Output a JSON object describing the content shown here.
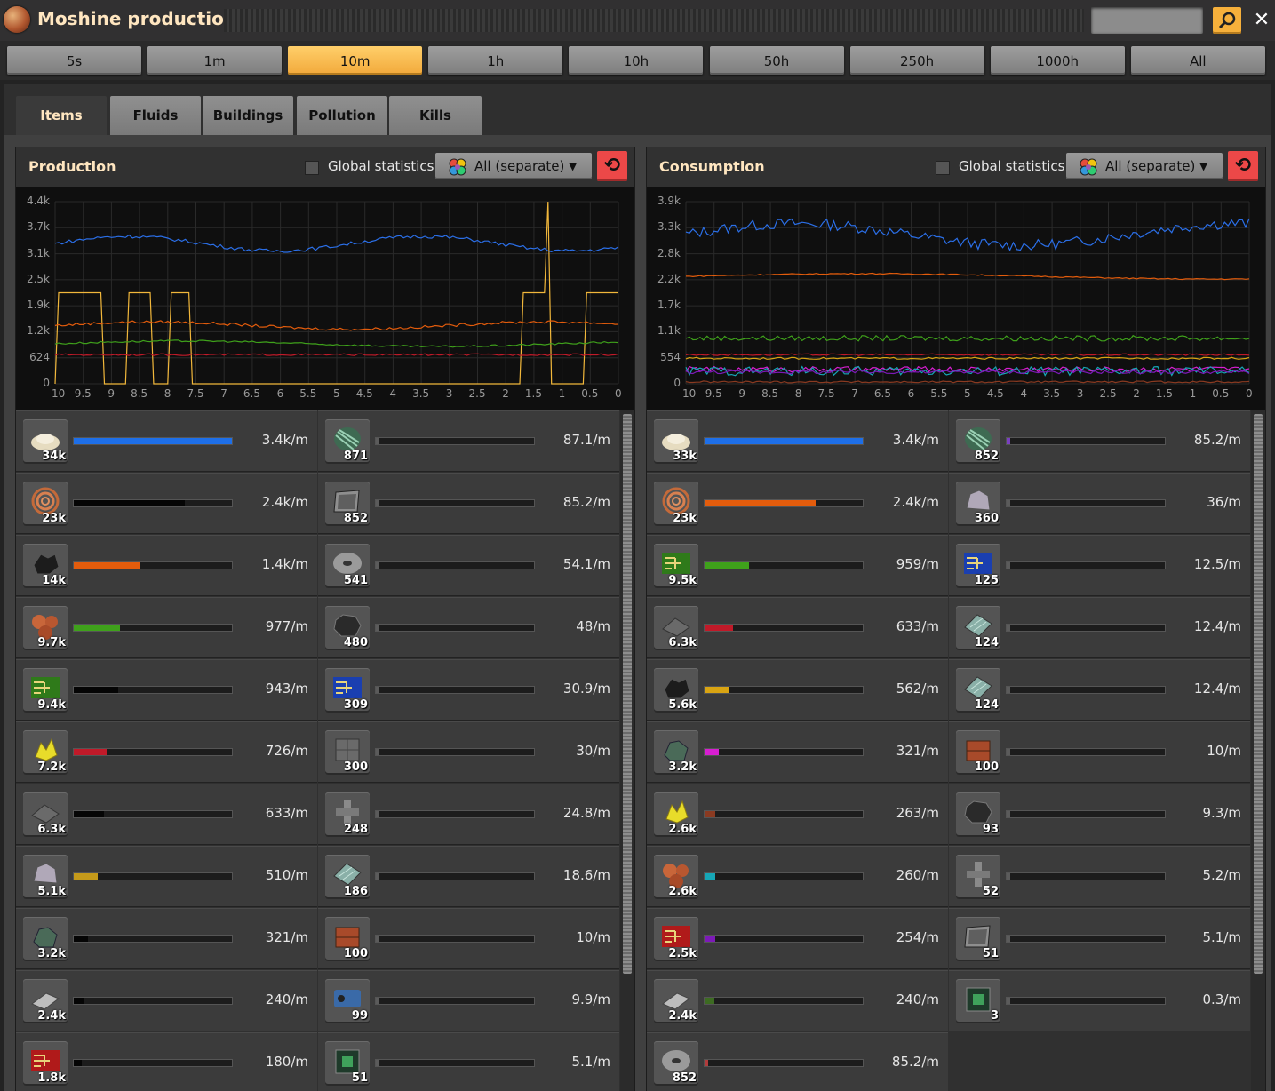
{
  "window": {
    "title": "Moshine production",
    "close_label": "✕"
  },
  "time_buttons": [
    "5s",
    "1m",
    "10m",
    "1h",
    "10h",
    "50h",
    "250h",
    "1000h",
    "All"
  ],
  "active_time": "10m",
  "tabs": [
    "Items",
    "Fluids",
    "Buildings",
    "Pollution",
    "Kills"
  ],
  "active_tab": "Items",
  "production": {
    "title": "Production",
    "global_label": "Global statistics",
    "dropdown_label": "All (separate)",
    "chart_data": {
      "type": "line",
      "x_labels": [
        "10",
        "9.5",
        "9",
        "8.5",
        "8",
        "7.5",
        "7",
        "6.5",
        "6",
        "5.5",
        "5",
        "4.5",
        "4",
        "3.5",
        "3",
        "2.5",
        "2",
        "1.5",
        "1",
        "0.5",
        "0"
      ],
      "y_labels": [
        "4.4k",
        "3.7k",
        "3.1k",
        "2.5k",
        "1.9k",
        "1.2k",
        "624",
        "0"
      ],
      "ylim": [
        0,
        4400
      ]
    },
    "items": [
      {
        "icon": "sand-icon",
        "count": "34k",
        "rate": "3.4k/m",
        "fraction": 1.0,
        "color": "#1e6fe8"
      },
      {
        "icon": "fiber-icon",
        "count": "871",
        "rate": "87.1/m",
        "fraction": 0.02,
        "color": "#5b5b5b"
      },
      {
        "icon": "copper-cable-icon",
        "count": "23k",
        "rate": "2.4k/m",
        "fraction": 0.7,
        "color": "#050505"
      },
      {
        "icon": "panel-icon",
        "count": "852",
        "rate": "85.2/m",
        "fraction": 0.02,
        "color": "#5b5b5b"
      },
      {
        "icon": "coal-icon",
        "count": "14k",
        "rate": "1.4k/m",
        "fraction": 0.42,
        "color": "#e35c0c"
      },
      {
        "icon": "disk-icon",
        "count": "541",
        "rate": "54.1/m",
        "fraction": 0.01,
        "color": "#5b5b5b"
      },
      {
        "icon": "copper-ore-icon",
        "count": "9.7k",
        "rate": "977/m",
        "fraction": 0.29,
        "color": "#3fa11b"
      },
      {
        "icon": "carbon-icon",
        "count": "480",
        "rate": "48/m",
        "fraction": 0.01,
        "color": "#5b5b5b"
      },
      {
        "icon": "green-circuit-icon",
        "count": "9.4k",
        "rate": "943/m",
        "fraction": 0.28,
        "color": "#050505"
      },
      {
        "icon": "blue-circuit-icon",
        "count": "309",
        "rate": "30.9/m",
        "fraction": 0.01,
        "color": "#5b5b5b"
      },
      {
        "icon": "sulfur-icon",
        "count": "7.2k",
        "rate": "726/m",
        "fraction": 0.21,
        "color": "#c11a29"
      },
      {
        "icon": "concrete-icon",
        "count": "300",
        "rate": "30/m",
        "fraction": 0.01,
        "color": "#5b5b5b"
      },
      {
        "icon": "stone-plate-icon",
        "count": "6.3k",
        "rate": "633/m",
        "fraction": 0.19,
        "color": "#050505"
      },
      {
        "icon": "pipe-icon",
        "count": "248",
        "rate": "24.8/m",
        "fraction": 0.01,
        "color": "#5b5b5b"
      },
      {
        "icon": "stone-icon",
        "count": "5.1k",
        "rate": "510/m",
        "fraction": 0.15,
        "color": "#c59a1a"
      },
      {
        "icon": "glass-icon",
        "count": "186",
        "rate": "18.6/m",
        "fraction": 0.01,
        "color": "#5b5b5b"
      },
      {
        "icon": "ore-icon",
        "count": "3.2k",
        "rate": "321/m",
        "fraction": 0.09,
        "color": "#050505"
      },
      {
        "icon": "brick-icon",
        "count": "100",
        "rate": "10/m",
        "fraction": 0.005,
        "color": "#5b5b5b"
      },
      {
        "icon": "steel-icon",
        "count": "2.4k",
        "rate": "240/m",
        "fraction": 0.07,
        "color": "#050505"
      },
      {
        "icon": "engine-icon",
        "count": "99",
        "rate": "9.9/m",
        "fraction": 0.005,
        "color": "#5b5b5b"
      },
      {
        "icon": "red-circuit-icon",
        "count": "1.8k",
        "rate": "180/m",
        "fraction": 0.05,
        "color": "#050505"
      },
      {
        "icon": "module-icon",
        "count": "51",
        "rate": "5.1/m",
        "fraction": 0.004,
        "color": "#5b5b5b"
      }
    ]
  },
  "consumption": {
    "title": "Consumption",
    "global_label": "Global statistics",
    "dropdown_label": "All (separate)",
    "chart_data": {
      "type": "line",
      "x_labels": [
        "10",
        "9.5",
        "9",
        "8.5",
        "8",
        "7.5",
        "7",
        "6.5",
        "6",
        "5.5",
        "5",
        "4.5",
        "4",
        "3.5",
        "3",
        "2.5",
        "2",
        "1.5",
        "1",
        "0.5",
        "0"
      ],
      "y_labels": [
        "3.9k",
        "3.3k",
        "2.8k",
        "2.2k",
        "1.7k",
        "1.1k",
        "554",
        "0"
      ],
      "ylim": [
        0,
        3900
      ]
    },
    "items": [
      {
        "icon": "sand-icon",
        "count": "33k",
        "rate": "3.4k/m",
        "fraction": 1.0,
        "color": "#1e6fe8"
      },
      {
        "icon": "fiber-icon",
        "count": "852",
        "rate": "85.2/m",
        "fraction": 0.02,
        "color": "#7a3fc1"
      },
      {
        "icon": "copper-cable-icon",
        "count": "23k",
        "rate": "2.4k/m",
        "fraction": 0.7,
        "color": "#e35c0c"
      },
      {
        "icon": "stone-icon",
        "count": "360",
        "rate": "36/m",
        "fraction": 0.01,
        "color": "#5b5b5b"
      },
      {
        "icon": "green-circuit-icon",
        "count": "9.5k",
        "rate": "959/m",
        "fraction": 0.28,
        "color": "#3fa11b"
      },
      {
        "icon": "blue-circuit-icon",
        "count": "125",
        "rate": "12.5/m",
        "fraction": 0.005,
        "color": "#5b5b5b"
      },
      {
        "icon": "stone-plate-icon",
        "count": "6.3k",
        "rate": "633/m",
        "fraction": 0.18,
        "color": "#c11a29"
      },
      {
        "icon": "glass-icon",
        "count": "124",
        "rate": "12.4/m",
        "fraction": 0.005,
        "color": "#5b5b5b"
      },
      {
        "icon": "coal-icon",
        "count": "5.6k",
        "rate": "562/m",
        "fraction": 0.16,
        "color": "#d9a412"
      },
      {
        "icon": "glass-icon",
        "count": "124",
        "rate": "12.4/m",
        "fraction": 0.005,
        "color": "#5b5b5b"
      },
      {
        "icon": "ore-icon",
        "count": "3.2k",
        "rate": "321/m",
        "fraction": 0.09,
        "color": "#d71ed1"
      },
      {
        "icon": "brick-icon",
        "count": "100",
        "rate": "10/m",
        "fraction": 0.005,
        "color": "#5b5b5b"
      },
      {
        "icon": "sulfur-icon",
        "count": "2.6k",
        "rate": "263/m",
        "fraction": 0.07,
        "color": "#8a3a21"
      },
      {
        "icon": "carbon-icon",
        "count": "93",
        "rate": "9.3/m",
        "fraction": 0.004,
        "color": "#5b5b5b"
      },
      {
        "icon": "copper-ore-icon",
        "count": "2.6k",
        "rate": "260/m",
        "fraction": 0.07,
        "color": "#16a6b6"
      },
      {
        "icon": "pipe-icon",
        "count": "52",
        "rate": "5.2/m",
        "fraction": 0.003,
        "color": "#5b5b5b"
      },
      {
        "icon": "red-circuit-icon",
        "count": "2.5k",
        "rate": "254/m",
        "fraction": 0.07,
        "color": "#7d1ab8"
      },
      {
        "icon": "panel-icon",
        "count": "51",
        "rate": "5.1/m",
        "fraction": 0.003,
        "color": "#5b5b5b"
      },
      {
        "icon": "steel-icon",
        "count": "2.4k",
        "rate": "240/m",
        "fraction": 0.06,
        "color": "#3d6b22"
      },
      {
        "icon": "module-icon",
        "count": "3",
        "rate": "0.3/m",
        "fraction": 0.001,
        "color": "#5b5b5b"
      },
      {
        "icon": "disk-icon",
        "count": "852",
        "rate": "85.2/m",
        "fraction": 0.02,
        "color": "#b23c3c"
      }
    ]
  }
}
